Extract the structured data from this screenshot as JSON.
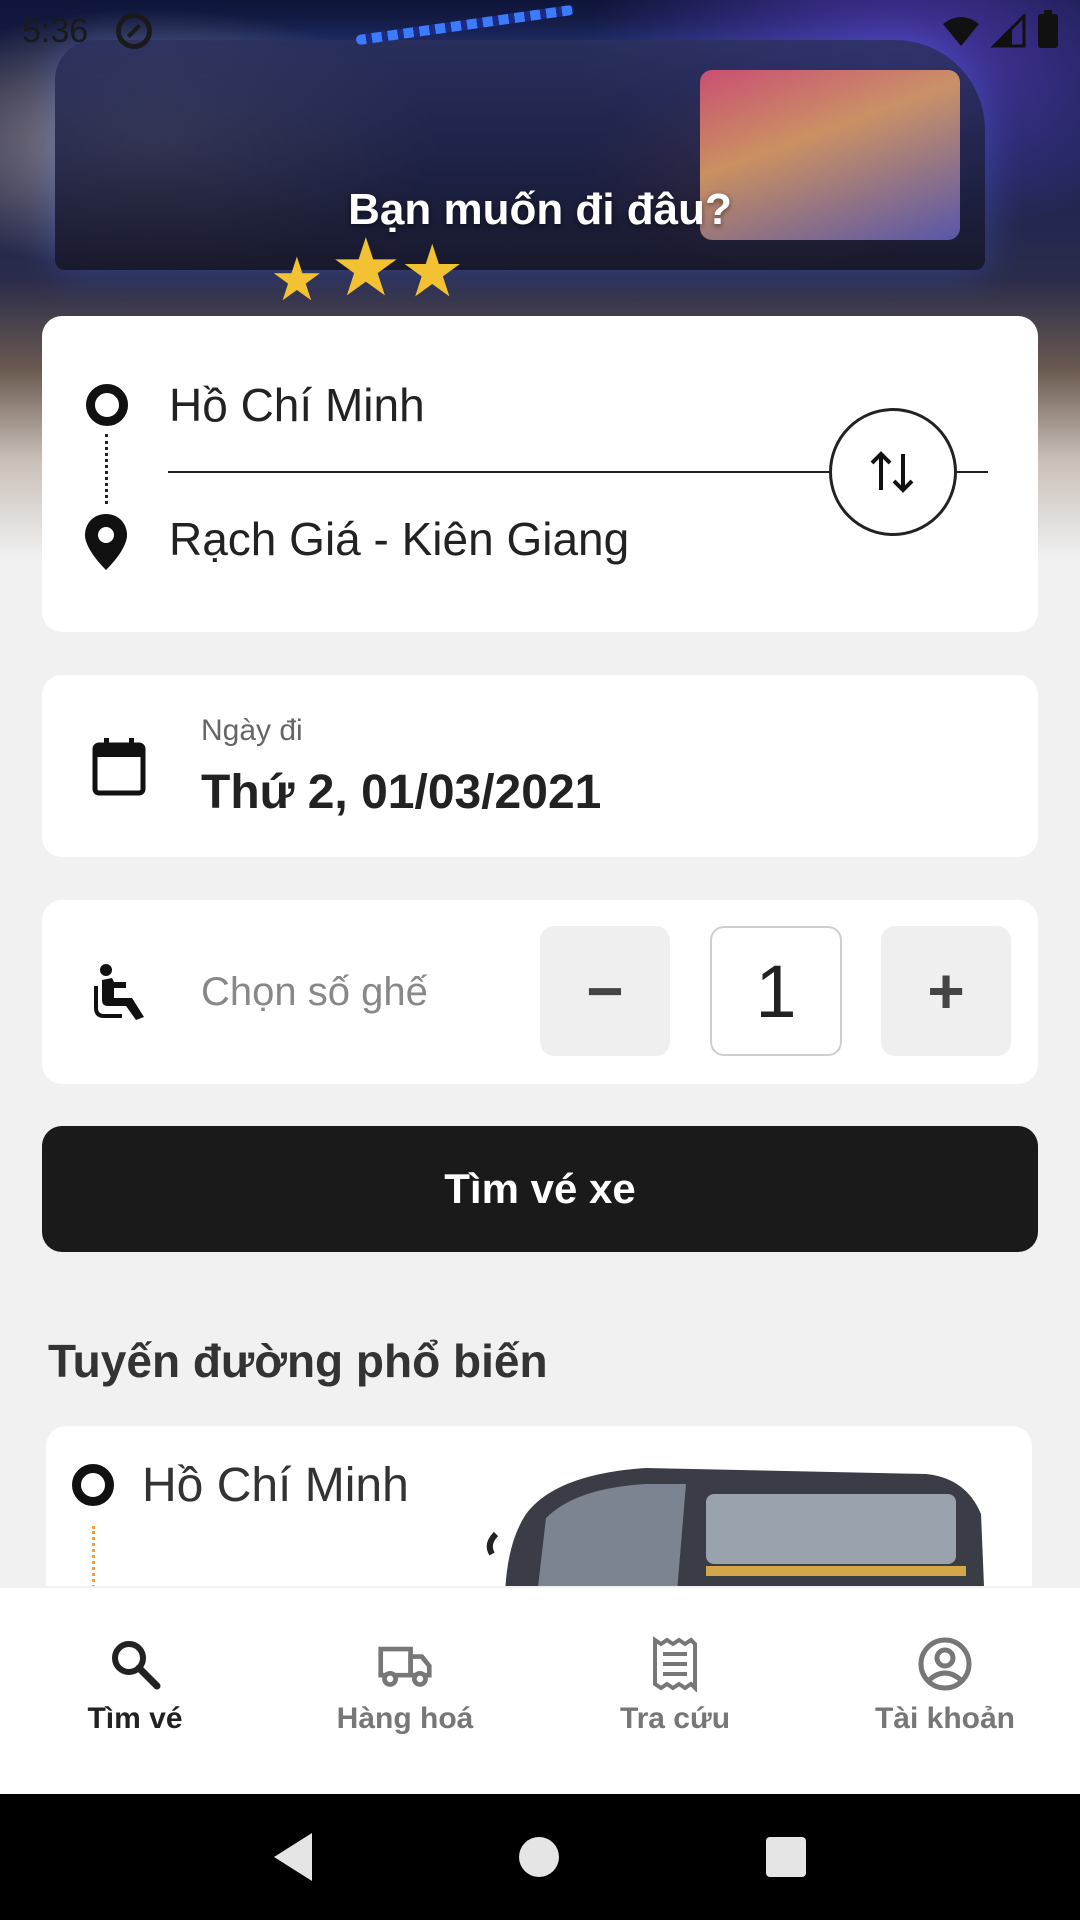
{
  "status_bar": {
    "time": "5:36"
  },
  "hero": {
    "title": "Bạn muốn đi đâu?"
  },
  "route": {
    "origin": "Hồ Chí Minh",
    "destination": "Rạch Giá - Kiên Giang"
  },
  "date": {
    "label": "Ngày đi",
    "value": "Thứ 2, 01/03/2021"
  },
  "seats": {
    "label": "Chọn số ghế",
    "minus": "−",
    "quantity": "1",
    "plus": "+"
  },
  "search_button": {
    "label": "Tìm vé xe"
  },
  "popular": {
    "title": "Tuyến đường phổ biến",
    "items": [
      {
        "origin": "Hồ Chí Minh"
      }
    ]
  },
  "bottom_nav": [
    {
      "label": "Tìm vé",
      "icon": "search-icon",
      "active": true
    },
    {
      "label": "Hàng hoá",
      "icon": "truck-icon",
      "active": false
    },
    {
      "label": "Tra cứu",
      "icon": "receipt-icon",
      "active": false
    },
    {
      "label": "Tài khoản",
      "icon": "account-icon",
      "active": false
    }
  ],
  "colors": {
    "primary": "#1a1a1a",
    "background": "#f1f1f1",
    "accent_dots": "#f0a030"
  }
}
